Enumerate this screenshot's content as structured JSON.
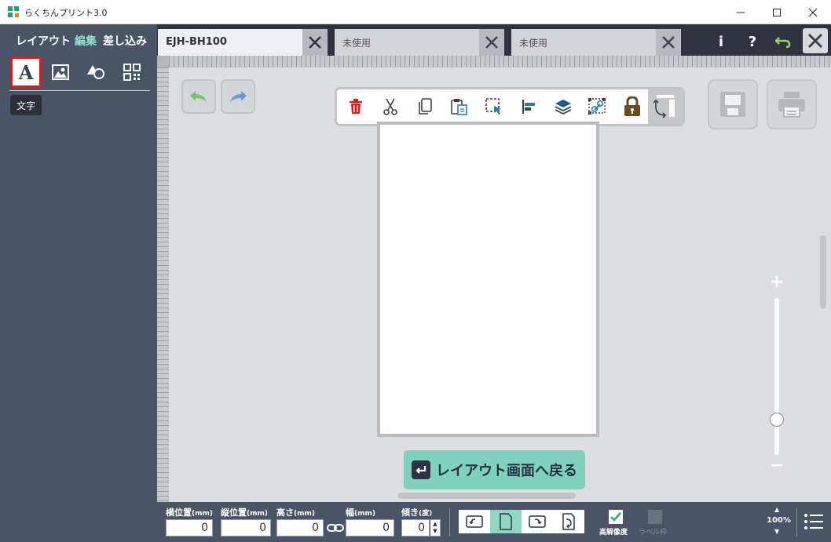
{
  "window": {
    "title": "らくちんプリント3.0"
  },
  "left_panel": {
    "tabs": [
      {
        "label": "レイアウト",
        "active": false
      },
      {
        "label": "編集",
        "active": true
      },
      {
        "label": "差し込み",
        "active": false
      }
    ],
    "tools": [
      {
        "icon": "text-icon",
        "selected": true
      },
      {
        "icon": "image-icon",
        "selected": false
      },
      {
        "icon": "shape-icon",
        "selected": false
      },
      {
        "icon": "qr-code-icon",
        "selected": false
      }
    ],
    "tooltip": "文字"
  },
  "tabs": [
    {
      "label": "EJH-BH100",
      "active": true
    },
    {
      "label": "未使用",
      "active": false
    },
    {
      "label": "未使用",
      "active": false
    }
  ],
  "top_buttons": {
    "info": "i",
    "help": "?"
  },
  "edit_toolbar": {
    "icons": [
      "delete-icon",
      "cut-icon",
      "copy-icon",
      "paste-icon",
      "select-icon",
      "align-icon",
      "layers-icon",
      "group-icon",
      "lock-icon",
      "transform-icon"
    ]
  },
  "canvas": {
    "return_button": "レイアウト画面へ戻る"
  },
  "bottom": {
    "fields": [
      {
        "label": "横位置",
        "unit": "(mm)",
        "value": "0"
      },
      {
        "label": "縦位置",
        "unit": "(mm)",
        "value": "0"
      },
      {
        "label": "高さ",
        "unit": "(mm)",
        "value": "0"
      },
      {
        "label": "幅",
        "unit": "(mm)",
        "value": "0"
      },
      {
        "label": "傾き",
        "unit": "(度)",
        "value": "0"
      }
    ],
    "orientation_selected": 2,
    "high_res": {
      "label": "高解像度",
      "checked": true
    },
    "label_frame": {
      "label": "ラベル枠",
      "checked": false,
      "enabled": false
    },
    "zoom": "100%"
  },
  "colors": {
    "panel": "#4b5467",
    "accent": "#8fd7c2",
    "delete_red": "#e01818",
    "lock_brown": "#6a4a22",
    "selection_red": "#e01818"
  }
}
